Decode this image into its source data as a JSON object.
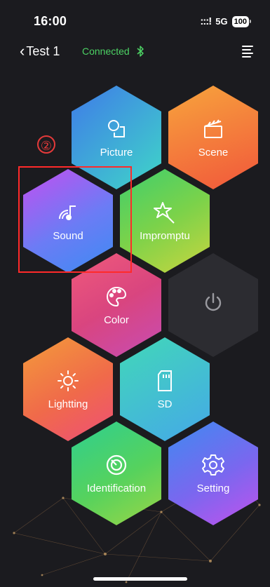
{
  "status_bar": {
    "time": "16:00",
    "signal": ":::!",
    "network": "5G",
    "battery": "100"
  },
  "nav": {
    "back_label": "Test 1",
    "connection_status": "Connected",
    "bluetooth_icon": "bluetooth-icon",
    "menu_icon": "menu-icon"
  },
  "annotation": {
    "marker": "②"
  },
  "tiles": [
    {
      "label": "Picture",
      "icon": "picture-icon"
    },
    {
      "label": "Scene",
      "icon": "clapperboard-icon"
    },
    {
      "label": "Sound",
      "icon": "music-note-icon"
    },
    {
      "label": "Impromptu",
      "icon": "magic-star-icon"
    },
    {
      "label": "Color",
      "icon": "palette-icon"
    },
    {
      "label": "",
      "icon": "power-icon"
    },
    {
      "label": "Lightting",
      "icon": "sun-icon"
    },
    {
      "label": "SD",
      "icon": "sd-card-icon"
    },
    {
      "label": "Identification",
      "icon": "target-icon"
    },
    {
      "label": "Setting",
      "icon": "gear-icon"
    }
  ],
  "colors": {
    "connected": "#4cd264",
    "background": "#1b1b1f",
    "annotation": "#e53a3a"
  }
}
